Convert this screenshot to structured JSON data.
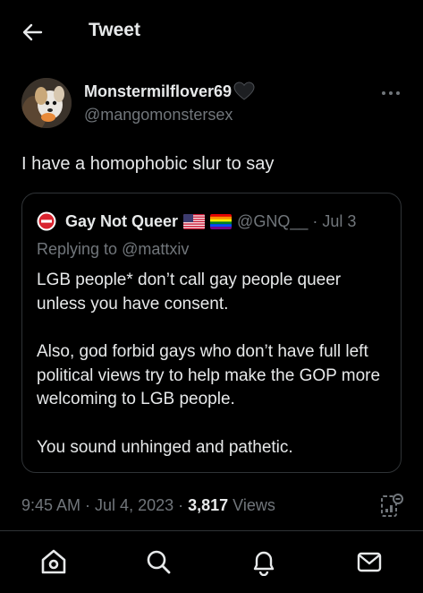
{
  "header": {
    "title": "Tweet",
    "back_icon": "arrow-left-icon"
  },
  "tweet": {
    "display_name": "Monstermilflover69",
    "handle": "@mangomonstersex",
    "text": "I have a homophobic slur to say",
    "more_icon": "ellipsis-icon",
    "heart_icon": "black-heart-icon"
  },
  "quote": {
    "display_name": "Gay Not Queer",
    "handle": "@GNQ__",
    "separator": "·",
    "date": "Jul 3",
    "replying_prefix": "Replying to ",
    "replying_to": "@mattxiv",
    "paragraphs": [
      "LGB people* don’t call gay people queer unless you have consent.",
      "Also, god forbid gays who don’t have full left political views try to help make the GOP more welcoming to LGB people.",
      "You sound unhinged and pathetic."
    ]
  },
  "meta": {
    "time": "9:45 AM",
    "sep1": " · ",
    "date": "Jul 4, 2023",
    "sep2": " · ",
    "views_count": "3,817",
    "views_label": " Views"
  },
  "bottom_nav": {
    "items": [
      "home-icon",
      "search-icon",
      "notifications-icon",
      "messages-icon"
    ]
  },
  "colors": {
    "background": "#000000",
    "text_primary": "#e7e9ea",
    "text_secondary": "#71767b",
    "border": "#2f3336"
  }
}
